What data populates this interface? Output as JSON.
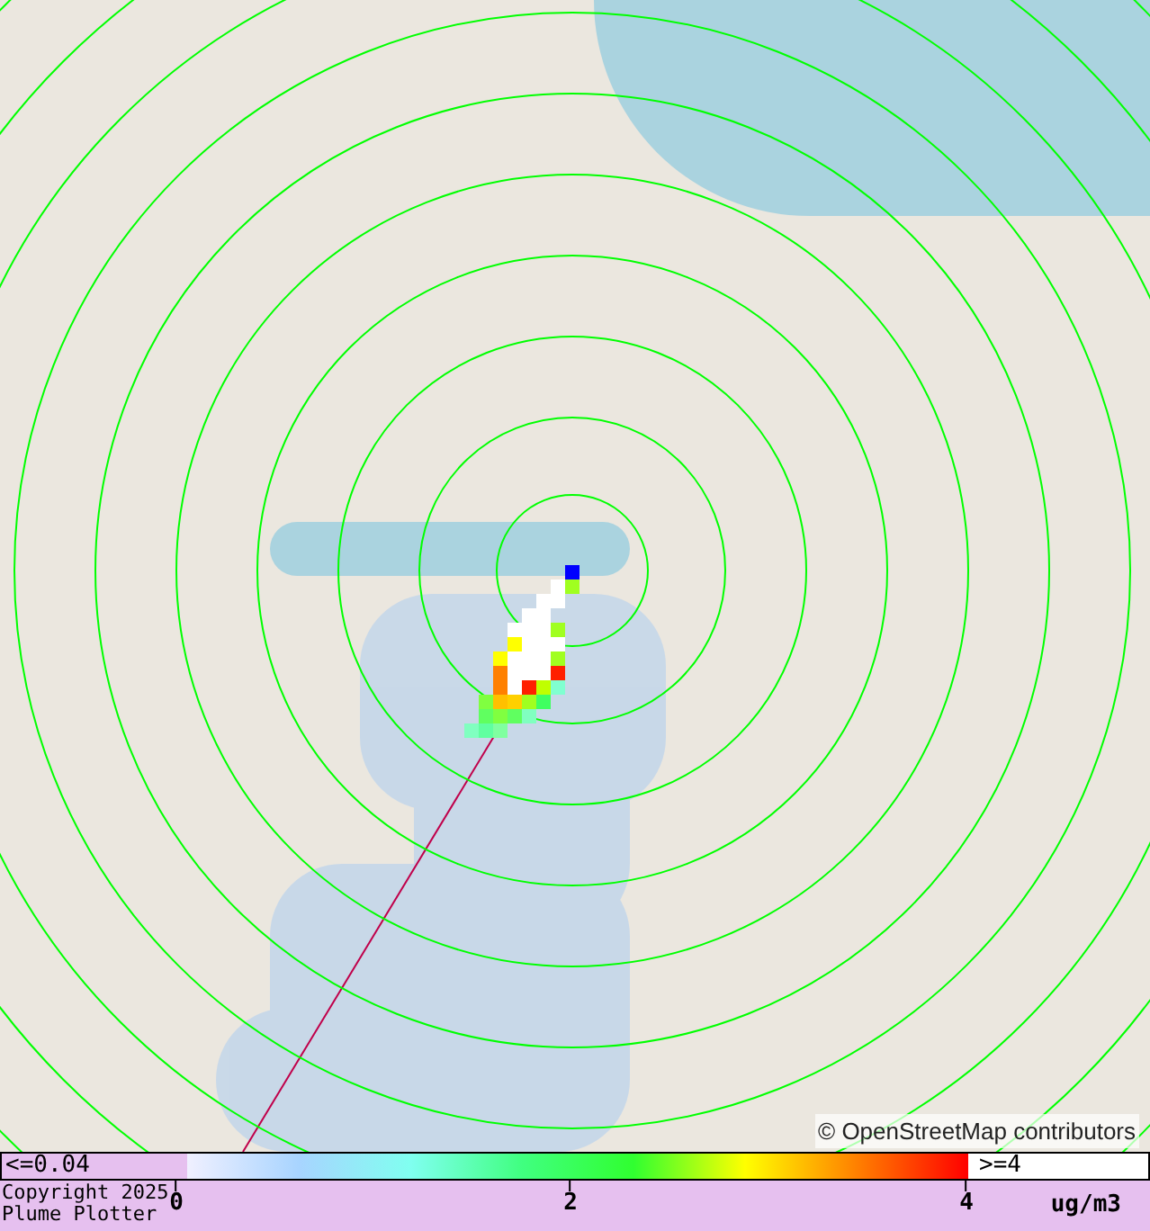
{
  "map": {
    "attribution": "© OpenStreetMap contributors"
  },
  "legend": {
    "min_label": "<=0.04",
    "max_label": ">=4",
    "ticks": [
      "0",
      "2",
      "4"
    ],
    "unit": "ug/m3"
  },
  "footer": {
    "copyright": "Copyright 2025",
    "app_name": "Plume Plotter"
  }
}
